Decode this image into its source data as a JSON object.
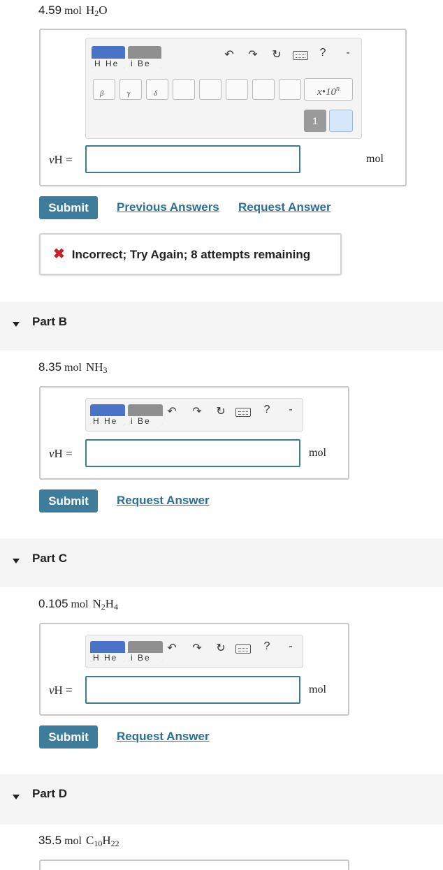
{
  "partA": {
    "question": {
      "amount": "4.59",
      "unit": "mol",
      "formula_main": "H",
      "formula_sub": "2",
      "formula_end": "O"
    },
    "toolbar": {
      "periodic_tile_1": "H  He",
      "periodic_tile_2": "i  Be",
      "greek_1": "β",
      "greek_2": "γ",
      "greek_3": "δ",
      "sci_notation_base": "x•10",
      "sci_notation_exp": "n",
      "key_value": "1"
    },
    "variable": "ν",
    "variable_sub": "H",
    "equals": "=",
    "unit_label": "mol",
    "submit_label": "Submit",
    "previous_answers_label": "Previous Answers",
    "request_answer_label": "Request Answer",
    "feedback": "Incorrect; Try Again; 8 attempts remaining"
  },
  "partB": {
    "title": "Part B",
    "question": {
      "amount": "8.35",
      "unit": "mol",
      "formula_main": "NH",
      "formula_sub": "3"
    },
    "toolbar": {
      "periodic_tile_1": "H  He",
      "periodic_tile_2": "i  Be"
    },
    "variable": "ν",
    "variable_sub": "H",
    "equals": "=",
    "unit_label": "mol",
    "submit_label": "Submit",
    "request_answer_label": "Request Answer"
  },
  "partC": {
    "title": "Part C",
    "question": {
      "amount": "0.105",
      "unit": "mol",
      "formula_main": "N",
      "formula_sub": "2",
      "formula_end": "H",
      "formula_sub2": "4"
    },
    "toolbar": {
      "periodic_tile_1": "H  He",
      "periodic_tile_2": "i  Be"
    },
    "variable": "ν",
    "variable_sub": "H",
    "equals": "=",
    "unit_label": "mol",
    "submit_label": "Submit",
    "request_answer_label": "Request Answer"
  },
  "partD": {
    "title": "Part D",
    "question": {
      "amount": "35.5",
      "unit": "mol",
      "formula_main": "C",
      "formula_sub": "10",
      "formula_end": "H",
      "formula_sub2": "22"
    }
  },
  "colors": {
    "accent": "#3d7d9b",
    "link": "#2a6f97",
    "error": "#c8202d",
    "periodic_blue": "#4a73c8"
  },
  "icons": [
    "undo-icon",
    "redo-icon",
    "reset-icon",
    "keyboard-icon",
    "help-icon",
    "close-icon"
  ]
}
